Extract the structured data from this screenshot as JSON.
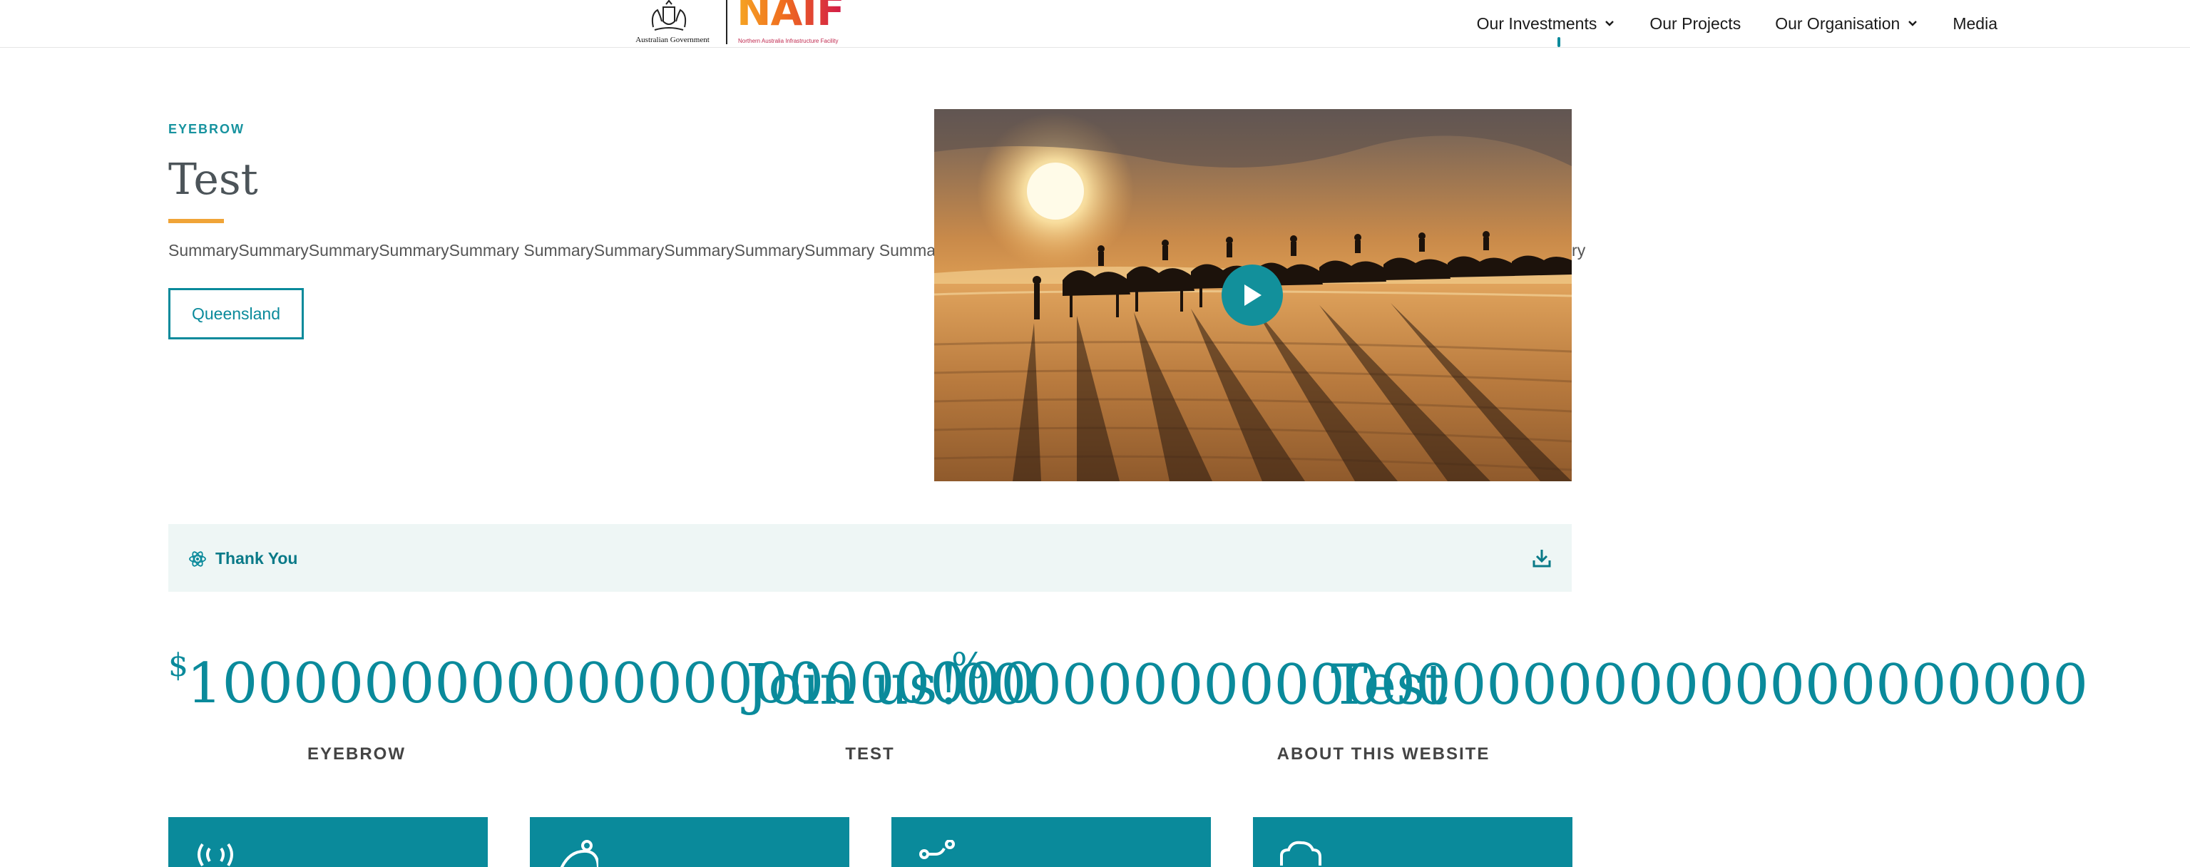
{
  "header": {
    "gov_text": "Australian Government",
    "brand": "NAIF",
    "brand_sub": "Northern Australia Infrastructure Facility",
    "nav": [
      {
        "label": "Our Investments",
        "has_dropdown": true
      },
      {
        "label": "Our Projects",
        "has_dropdown": false
      },
      {
        "label": "Our Organisation",
        "has_dropdown": true
      },
      {
        "label": "Media",
        "has_dropdown": false
      }
    ]
  },
  "hero": {
    "eyebrow": "EYEBROW",
    "title": "Test",
    "summary": "SummarySummarySummarySummarySummary SummarySummarySummarySummarySummary SummarySummarySummarySummarySummary SummarySummarySummarySummarySummary",
    "region_button": "Queensland",
    "video": {
      "play_icon": "play-icon"
    }
  },
  "download": {
    "label": "Thank You",
    "leading_icon": "atom-icon",
    "trailing_icon": "download-icon"
  },
  "stats": {
    "items": [
      {
        "prefix": "$",
        "value": "100000000000000000000000",
        "label": "EYEBROW"
      },
      {
        "value": "Join us!",
        "suffix": "%",
        "label": "TEST"
      },
      {
        "value": "Test",
        "label": "ABOUT THIS WEBSITE"
      }
    ],
    "overflow_digits": "00000000000000000000000000000000"
  },
  "cards": [
    {
      "icon": "signal-icon"
    },
    {
      "icon": "person-icon"
    },
    {
      "icon": "route-icon"
    },
    {
      "icon": "cloud-icon"
    }
  ],
  "colors": {
    "teal": "#0a8a9b",
    "accent": "#f0a437",
    "panel": "#eef6f5"
  }
}
